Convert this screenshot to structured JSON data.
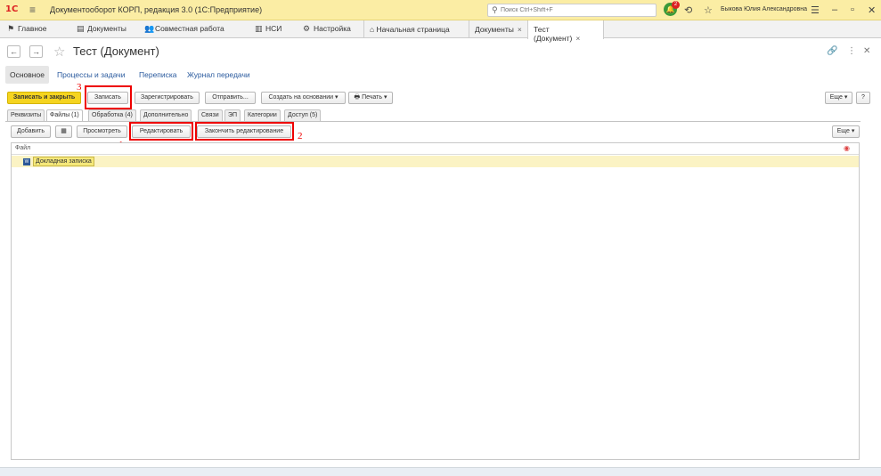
{
  "titlebar": {
    "logo": "1С",
    "app_title": "Документооборот КОРП, редакция 3.0  (1С:Предприятие)",
    "search_placeholder": "Поиск Ctrl+Shift+F",
    "notification_count": "2",
    "user_name": "Быкова Юлия Александровна"
  },
  "sections": {
    "main": "Главное",
    "documents": "Документы",
    "collab": "Совместная работа",
    "nsi": "НСИ",
    "settings": "Настройка"
  },
  "open_tabs": {
    "home": "Начальная страница",
    "documents": "Документы",
    "current": "Тест (Документ)"
  },
  "document": {
    "title": "Тест (Документ)"
  },
  "panel_links": {
    "main": "Основное",
    "processes": "Процессы и задачи",
    "correspondence": "Переписка",
    "transfer_log": "Журнал передачи"
  },
  "toolbar": {
    "save_close": "Записать и закрыть",
    "save": "Записать",
    "register": "Зарегистрировать",
    "send": "Отправить...",
    "create_based": "Создать на основании",
    "print": "Печать",
    "more": "Еще",
    "help": "?"
  },
  "tabs": {
    "requisites": "Реквизиты",
    "files": "Файлы (1)",
    "processing": "Обработка (4)",
    "additional": "Дополнительно",
    "links": "Связи",
    "ep": "ЭП",
    "categories": "Категории",
    "access": "Доступ (5)"
  },
  "files_toolbar": {
    "add": "Добавить",
    "view": "Просмотреть",
    "edit": "Редактировать",
    "finish_edit": "Закончить редактирование",
    "more": "Еще"
  },
  "file_table": {
    "column_header": "Файл",
    "rows": [
      {
        "name": "Докладная записка",
        "icon": "word-doc-icon"
      }
    ]
  },
  "annotations": {
    "n1": "1",
    "n2": "2",
    "n3": "3"
  },
  "colors": {
    "titlebar_bg": "#fbeda4",
    "primary_button": "#f5d41f",
    "highlight_box": "#ee0000",
    "link": "#2a5a9e",
    "selected_row": "#fbf3c4"
  }
}
